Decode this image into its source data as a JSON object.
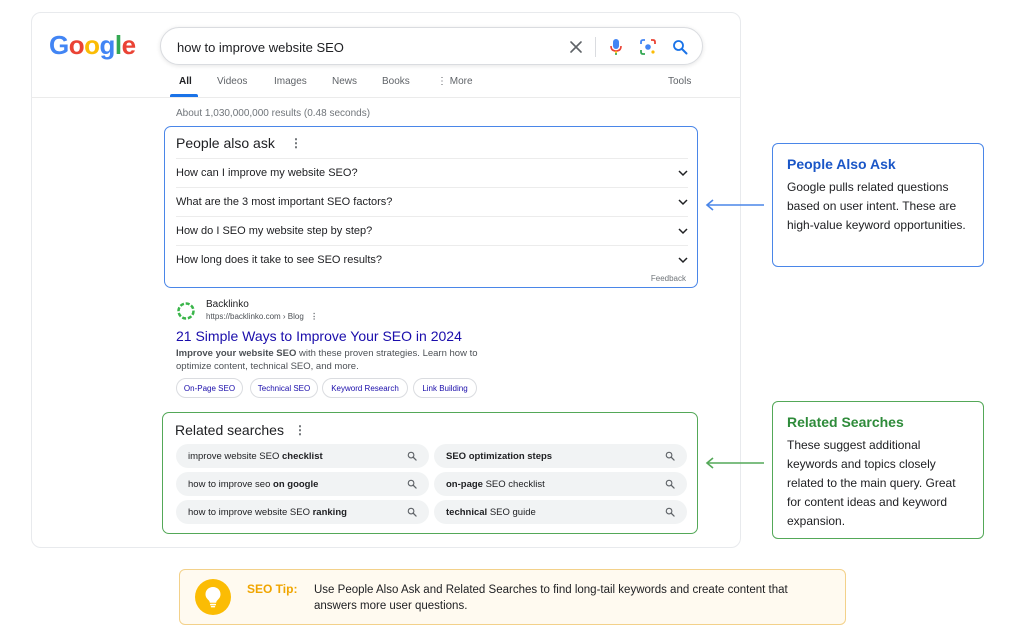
{
  "brand": {
    "logo_letters": [
      "G",
      "o",
      "o",
      "g",
      "l",
      "e"
    ],
    "logo_colors": [
      "#4285f4",
      "#ea4335",
      "#fbbc05",
      "#4285f4",
      "#34a853",
      "#ea4335"
    ]
  },
  "search": {
    "query": "how to improve website SEO",
    "icons": [
      "close-icon",
      "microphone-icon",
      "lens-icon",
      "search-icon"
    ]
  },
  "tabs": [
    {
      "label": "All",
      "active": true
    },
    {
      "label": "Videos"
    },
    {
      "label": "Images"
    },
    {
      "label": "News"
    },
    {
      "label": "Books"
    },
    {
      "label": "⋮ More"
    },
    {
      "label": "Tools"
    }
  ],
  "result_stats": "About 1,030,000,000 results (0.48 seconds)",
  "people_also_ask": {
    "title": "People also ask",
    "questions": [
      "How can I improve my website SEO?",
      "What are the 3 most important SEO factors?",
      "How do I SEO my website step by step?",
      "How long does it take to see SEO results?"
    ],
    "feedback": "Feedback"
  },
  "result": {
    "site_name": "Backlinko",
    "site_url": "https://backlinko.com › Blog",
    "title": "21 Simple Ways to Improve Your SEO in 2024",
    "snippet_bold": "Improve your website SEO",
    "snippet_rest": " with these proven strategies. Learn how to optimize content, technical SEO, and more.",
    "chips": [
      "On-Page SEO",
      "Technical SEO",
      "Keyword Research",
      "Link Building"
    ]
  },
  "related_searches": {
    "title": "Related searches",
    "items": [
      {
        "normal": "improve website SEO ",
        "bold": "checklist",
        "bold_first": false
      },
      {
        "normal": "",
        "bold": "SEO optimization steps",
        "bold_first": true
      },
      {
        "normal": "how to improve seo ",
        "bold": "on google",
        "bold_first": false
      },
      {
        "normal": " SEO checklist",
        "bold": "on-page",
        "bold_first": true
      },
      {
        "normal": "how to improve website SEO ",
        "bold": "ranking",
        "bold_first": false
      },
      {
        "normal": " SEO guide",
        "bold": "technical",
        "bold_first": true
      }
    ]
  },
  "callouts": {
    "paa": {
      "title": "People Also Ask",
      "body": "Google pulls related questions based on user intent. These are high-value keyword opportunities.",
      "color": "#4a86e8"
    },
    "rs": {
      "title": "Related Searches",
      "body": "These suggest additional keywords and topics closely related to the main query. Great for content ideas and keyword expansion.",
      "color": "#54a858"
    }
  },
  "tip": {
    "label": "SEO Tip:",
    "text": "Use People Also Ask and Related Searches to find long-tail keywords and create content that answers more user questions.",
    "icon": "lightbulb-icon"
  }
}
